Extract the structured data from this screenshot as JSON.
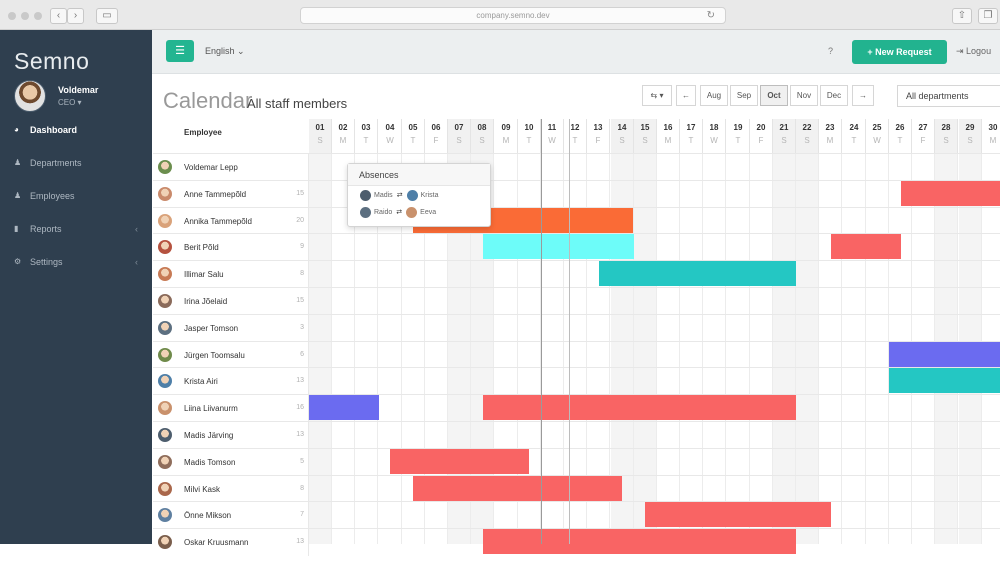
{
  "browser": {
    "url": "company.semno.dev",
    "back": "‹",
    "forward": "›"
  },
  "sidebar": {
    "brand": "Semno",
    "user_name": "Voldemar",
    "user_role": "CEO ▾",
    "items": [
      {
        "label": "Dashboard",
        "icon": "dashboard-icon",
        "glyph": "◕",
        "active": true,
        "chevron": ""
      },
      {
        "label": "Departments",
        "icon": "departments-icon",
        "glyph": "♟",
        "active": false,
        "chevron": ""
      },
      {
        "label": "Employees",
        "icon": "employees-icon",
        "glyph": "♟",
        "active": false,
        "chevron": ""
      },
      {
        "label": "Reports",
        "icon": "reports-icon",
        "glyph": "▮",
        "active": false,
        "chevron": "‹"
      },
      {
        "label": "Settings",
        "icon": "settings-icon",
        "glyph": "⚙",
        "active": false,
        "chevron": "‹"
      }
    ]
  },
  "topbar": {
    "menu_glyph": "☰",
    "language": "English ⌄",
    "help": "?",
    "new_request": "+ New Request",
    "logout": "⇥ Logou"
  },
  "calendar": {
    "title": "Calendar",
    "subtitle": "All staff members",
    "employee_header": "Employee",
    "controls": [
      "⇆ ▾",
      "←",
      "Aug",
      "Sep",
      "Oct",
      "Nov",
      "Dec",
      "→"
    ],
    "selected_control": "Oct",
    "department_filter": "All departments",
    "days": [
      {
        "n": "01",
        "w": "S"
      },
      {
        "n": "02",
        "w": "M"
      },
      {
        "n": "03",
        "w": "T"
      },
      {
        "n": "04",
        "w": "W"
      },
      {
        "n": "05",
        "w": "T"
      },
      {
        "n": "06",
        "w": "F"
      },
      {
        "n": "07",
        "w": "S"
      },
      {
        "n": "08",
        "w": "S"
      },
      {
        "n": "09",
        "w": "M"
      },
      {
        "n": "10",
        "w": "T"
      },
      {
        "n": "11",
        "w": "W"
      },
      {
        "n": "12",
        "w": "T"
      },
      {
        "n": "13",
        "w": "F"
      },
      {
        "n": "14",
        "w": "S"
      },
      {
        "n": "15",
        "w": "S"
      },
      {
        "n": "16",
        "w": "M"
      },
      {
        "n": "17",
        "w": "T"
      },
      {
        "n": "18",
        "w": "W"
      },
      {
        "n": "19",
        "w": "T"
      },
      {
        "n": "20",
        "w": "F"
      },
      {
        "n": "21",
        "w": "S"
      },
      {
        "n": "22",
        "w": "S"
      },
      {
        "n": "23",
        "w": "M"
      },
      {
        "n": "24",
        "w": "T"
      },
      {
        "n": "25",
        "w": "W"
      },
      {
        "n": "26",
        "w": "T"
      },
      {
        "n": "27",
        "w": "F"
      },
      {
        "n": "28",
        "w": "S"
      },
      {
        "n": "29",
        "w": "S"
      },
      {
        "n": "30",
        "w": "M"
      }
    ],
    "employees": [
      {
        "name": "Voldemar Lepp",
        "count": "",
        "avatar_color": "#6b8e4e"
      },
      {
        "name": "Anne Tammepõld",
        "count": "15",
        "avatar_color": "#c98a6b"
      },
      {
        "name": "Annika Tammepõld",
        "count": "20",
        "avatar_color": "#d9a27a"
      },
      {
        "name": "Berit Põld",
        "count": "9",
        "avatar_color": "#b5523f"
      },
      {
        "name": "Illimar Salu",
        "count": "8",
        "avatar_color": "#c77a55"
      },
      {
        "name": "Irina Jõelaid",
        "count": "15",
        "avatar_color": "#8a6a5a"
      },
      {
        "name": "Jasper Tomson",
        "count": "3",
        "avatar_color": "#5c6f80"
      },
      {
        "name": "Jürgen Toomsalu",
        "count": "6",
        "avatar_color": "#6f8a4a"
      },
      {
        "name": "Krista Airi",
        "count": "13",
        "avatar_color": "#4e7fa8"
      },
      {
        "name": "Liina Liivanurm",
        "count": "16",
        "avatar_color": "#c9916c"
      },
      {
        "name": "Madis Järving",
        "count": "13",
        "avatar_color": "#4d5d6d"
      },
      {
        "name": "Madis Tomson",
        "count": "5",
        "avatar_color": "#8f6d5b"
      },
      {
        "name": "Milvi Kask",
        "count": "8",
        "avatar_color": "#a9674b"
      },
      {
        "name": "Önne Mikson",
        "count": "7",
        "avatar_color": "#5e7fa0"
      },
      {
        "name": "Oskar Kruusmann",
        "count": "13",
        "avatar_color": "#7a5e4c"
      }
    ],
    "absences": [
      {
        "row": 1,
        "start": 26.5,
        "end": 31,
        "color": "#f96464"
      },
      {
        "row": 2,
        "start": 5.5,
        "end": 14,
        "color": "#fa6b36"
      },
      {
        "row": 3,
        "start": 8.5,
        "end": 14,
        "color": "#6dfcf9"
      },
      {
        "row": 3,
        "start": 23.5,
        "end": 25.5,
        "color": "#f96464"
      },
      {
        "row": 4,
        "start": 13.5,
        "end": 21,
        "color": "#24c7c3"
      },
      {
        "row": 7,
        "start": 26,
        "end": 31,
        "color": "#6b6bf0"
      },
      {
        "row": 8,
        "start": 26,
        "end": 31,
        "color": "#24c7c3"
      },
      {
        "row": 9,
        "start": 1,
        "end": 3,
        "color": "#6b6bf0"
      },
      {
        "row": 9,
        "start": 8.5,
        "end": 21,
        "color": "#f96464"
      },
      {
        "row": 11,
        "start": 4.5,
        "end": 9.5,
        "color": "#f96464"
      },
      {
        "row": 12,
        "start": 5.5,
        "end": 13.5,
        "color": "#f96464"
      },
      {
        "row": 13,
        "start": 15.5,
        "end": 22.5,
        "color": "#f96464"
      },
      {
        "row": 14,
        "start": 8.5,
        "end": 21,
        "color": "#f96464"
      }
    ],
    "popover": {
      "title": "Absences",
      "rows": [
        {
          "from": "Madis",
          "to": "Krista",
          "from_color": "#4d5d6d",
          "to_color": "#4e7fa8"
        },
        {
          "from": "Raido",
          "to": "Eeva",
          "from_color": "#5c6f80",
          "to_color": "#c9916c"
        }
      ],
      "swap": "⇄"
    }
  }
}
